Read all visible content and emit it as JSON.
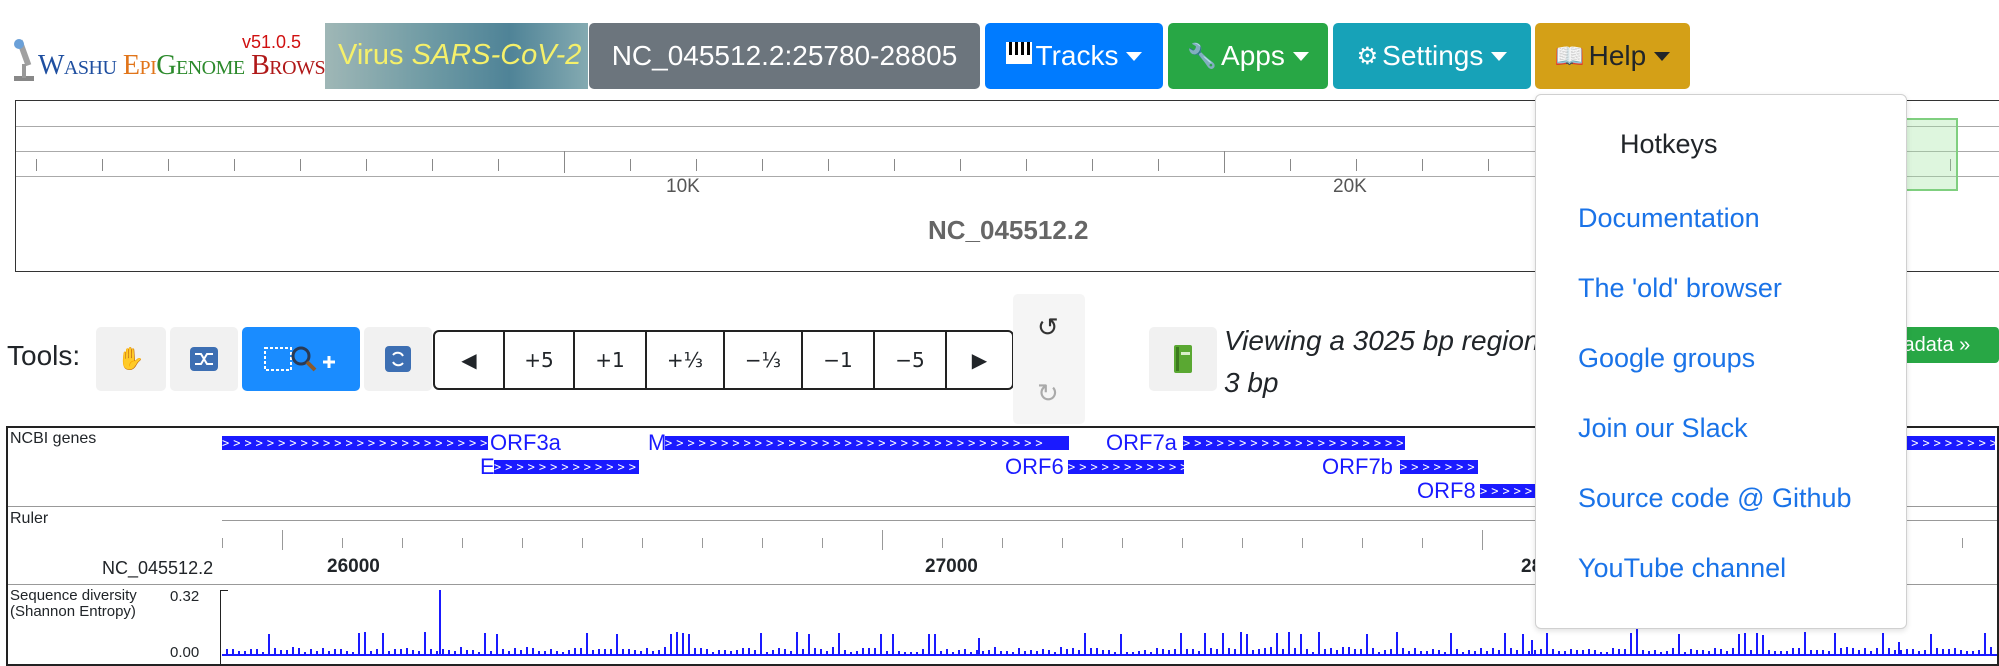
{
  "header": {
    "logo": {
      "version": "v51.0.5",
      "name_parts": [
        "Washu ",
        "Epi",
        "Genome ",
        "Browser"
      ]
    },
    "genome": {
      "prefix": "Virus ",
      "name": "SARS-CoV-2"
    },
    "coords": "NC_045512.2:25780-28805",
    "menus": {
      "tracks": {
        "label": "Tracks",
        "icon": "piano-keys-icon"
      },
      "apps": {
        "label": "Apps",
        "icon": "wrench-icon"
      },
      "settings": {
        "label": "Settings",
        "icon": "gear-icon"
      },
      "help": {
        "label": "Help",
        "icon": "book-icon"
      }
    }
  },
  "overview": {
    "ticks": [
      "10K",
      "20K"
    ],
    "chromosome": "NC_045512.2"
  },
  "tools": {
    "label": "Tools:",
    "nav_buttons": [
      "+5",
      "+1",
      "+⅓",
      "−⅓",
      "−1",
      "−5"
    ],
    "viewing_line1": "Viewing a 3025 bp region",
    "viewing_line2": "3 bp",
    "metadata_label": "tadata »"
  },
  "tracks": {
    "genes": {
      "label": "NCBI genes",
      "names": [
        "ORF3a",
        "M",
        "ORF7a",
        "E",
        "ORF6",
        "ORF7b",
        "ORF8"
      ]
    },
    "ruler": {
      "label": "Ruler",
      "chromosome": "NC_045512.2",
      "ticks": [
        "26000",
        "27000",
        "28"
      ]
    },
    "diversity": {
      "label_line1": "Sequence diversity",
      "label_line2": "(Shannon Entropy)",
      "max": "0.32",
      "min": "0.00"
    }
  },
  "help_menu": {
    "header": "Hotkeys",
    "items": [
      "Documentation",
      "The 'old' browser",
      "Google groups",
      "Join our Slack",
      "Source code @ Github",
      "YouTube channel"
    ]
  },
  "colors": {
    "tracks_button": "#007bff",
    "apps_button": "#28a745",
    "settings_button": "#17a2b8",
    "help_button": "#d4a017",
    "coords_button": "#6c757d",
    "gene_color": "#1a1aff",
    "link_color": "#1a73e8"
  }
}
